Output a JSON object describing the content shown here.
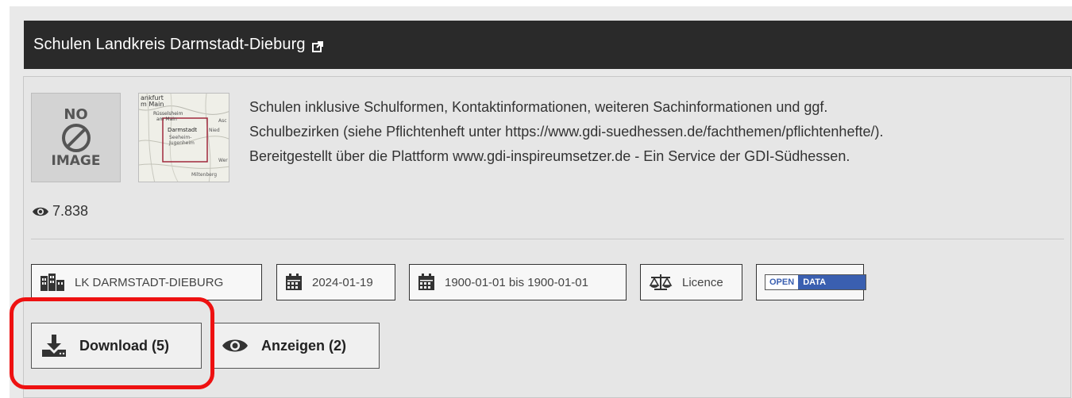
{
  "header": {
    "title": "Schulen Landkreis Darmstadt-Dieburg",
    "external_icon": "external-link-icon"
  },
  "preview": {
    "placeholder_line1": "NO",
    "placeholder_line2": "IMAGE",
    "map_labels": [
      "ankfurt",
      "m Main",
      "Rüsselsheim",
      "am Main",
      "Darmstadt",
      "Seeheim-",
      "Jugenheim",
      "Nied",
      "Miltenberg",
      "Asc",
      "Wer"
    ]
  },
  "description": {
    "lines": [
      "Schulen inklusive Schulformen, Kontaktinformationen, weiteren Sachinformationen und ggf.",
      "Schulbezirken (siehe Pflichtenheft unter https://www.gdi-suedhessen.de/fachthemen/pflichtenhefte/).",
      "Bereitgestellt über die Plattform www.gdi-inspireumsetzer.de - Ein Service der GDI-Südhessen."
    ]
  },
  "views": {
    "count": "7.838",
    "icon": "eye-icon"
  },
  "tags": {
    "organization": "LK DARMSTADT-DIEBURG",
    "date": "2024-01-19",
    "period": "1900-01-01 bis 1900-01-01",
    "licence": "Licence",
    "open_data_1": "OPEN",
    "open_data_2": "DATA"
  },
  "actions": {
    "download": "Download (5)",
    "view": "Anzeigen (2)"
  },
  "colors": {
    "header_bg": "#2a2a2a",
    "card_bg": "#e6e6e6",
    "highlight": "#ee1111",
    "open_data_blue": "#3a5fb0"
  }
}
